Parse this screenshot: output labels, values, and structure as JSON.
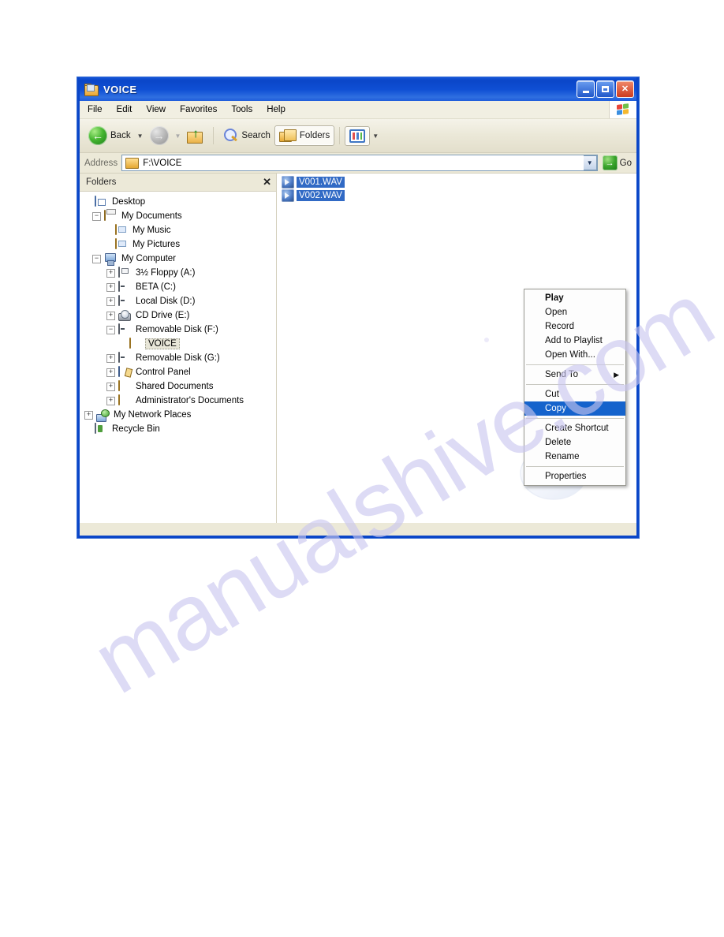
{
  "page": {
    "watermark": "manualshive.com"
  },
  "window": {
    "title": "VOICE",
    "title_icon": "folder-icon",
    "controls": {
      "minimize": "minimize-button",
      "maximize": "maximize-button",
      "close_label": "✕"
    },
    "menubar": {
      "items": [
        {
          "label": "File"
        },
        {
          "label": "Edit"
        },
        {
          "label": "View"
        },
        {
          "label": "Favorites"
        },
        {
          "label": "Tools"
        },
        {
          "label": "Help"
        }
      ],
      "logo": "windows-flag-logo"
    },
    "toolbar": {
      "back_label": "Back",
      "forward_label": "",
      "up_label": "",
      "search_label": "Search",
      "folders_label": "Folders",
      "views_label": ""
    },
    "address": {
      "label": "Address",
      "value": "F:\\VOICE",
      "go_label": "Go",
      "go_glyph": "→"
    },
    "folders_pane": {
      "header": "Folders",
      "close_glyph": "✕",
      "tree": [
        {
          "label": "Desktop",
          "icon": "desktop-icon",
          "indent": 0,
          "expander": "none"
        },
        {
          "label": "My Documents",
          "icon": "my-documents-icon",
          "indent": 1,
          "expander": "minus"
        },
        {
          "label": "My Music",
          "icon": "my-music-folder-icon",
          "indent": 2,
          "expander": "none"
        },
        {
          "label": "My Pictures",
          "icon": "my-pictures-folder-icon",
          "indent": 2,
          "expander": "none"
        },
        {
          "label": "My Computer",
          "icon": "my-computer-icon",
          "indent": 1,
          "expander": "minus"
        },
        {
          "label": "3½ Floppy (A:)",
          "icon": "floppy-drive-icon",
          "indent": 2,
          "expander": "plus"
        },
        {
          "label": "BETA (C:)",
          "icon": "hard-drive-icon",
          "indent": 2,
          "expander": "plus"
        },
        {
          "label": "Local Disk (D:)",
          "icon": "hard-drive-icon",
          "indent": 2,
          "expander": "plus"
        },
        {
          "label": "CD Drive (E:)",
          "icon": "cd-drive-icon",
          "indent": 2,
          "expander": "plus"
        },
        {
          "label": "Removable Disk (F:)",
          "icon": "removable-drive-icon",
          "indent": 2,
          "expander": "minus"
        },
        {
          "label": "VOICE",
          "icon": "folder-icon",
          "indent": 3,
          "expander": "none",
          "selected": true
        },
        {
          "label": "Removable Disk (G:)",
          "icon": "removable-drive-icon",
          "indent": 2,
          "expander": "plus"
        },
        {
          "label": "Control Panel",
          "icon": "control-panel-icon",
          "indent": 2,
          "expander": "plus"
        },
        {
          "label": "Shared Documents",
          "icon": "folder-icon",
          "indent": 2,
          "expander": "plus"
        },
        {
          "label": "Administrator's Documents",
          "icon": "folder-icon",
          "indent": 2,
          "expander": "plus"
        },
        {
          "label": "My Network Places",
          "icon": "network-places-icon",
          "indent": 1,
          "expander": "plus"
        },
        {
          "label": "Recycle Bin",
          "icon": "recycle-bin-icon",
          "indent": 1,
          "expander": "none"
        }
      ]
    },
    "file_pane": {
      "files": [
        {
          "name": "V001.WAV",
          "icon": "wav-file-icon",
          "selected": true
        },
        {
          "name": "V002.WAV",
          "icon": "wav-file-icon",
          "selected": true
        }
      ],
      "background_watermark": "music-note-icon"
    },
    "context_menu": {
      "items": [
        {
          "label": "Play",
          "bold": true
        },
        {
          "label": "Open"
        },
        {
          "label": "Record"
        },
        {
          "label": "Add to Playlist"
        },
        {
          "label": "Open With..."
        },
        {
          "separator": true
        },
        {
          "label": "Send To",
          "submenu": true,
          "arrow": "▶"
        },
        {
          "separator": true
        },
        {
          "label": "Cut"
        },
        {
          "label": "Copy",
          "highlighted": true
        },
        {
          "separator": true
        },
        {
          "label": "Create Shortcut"
        },
        {
          "label": "Delete"
        },
        {
          "label": "Rename"
        },
        {
          "separator": true
        },
        {
          "label": "Properties"
        }
      ]
    }
  }
}
